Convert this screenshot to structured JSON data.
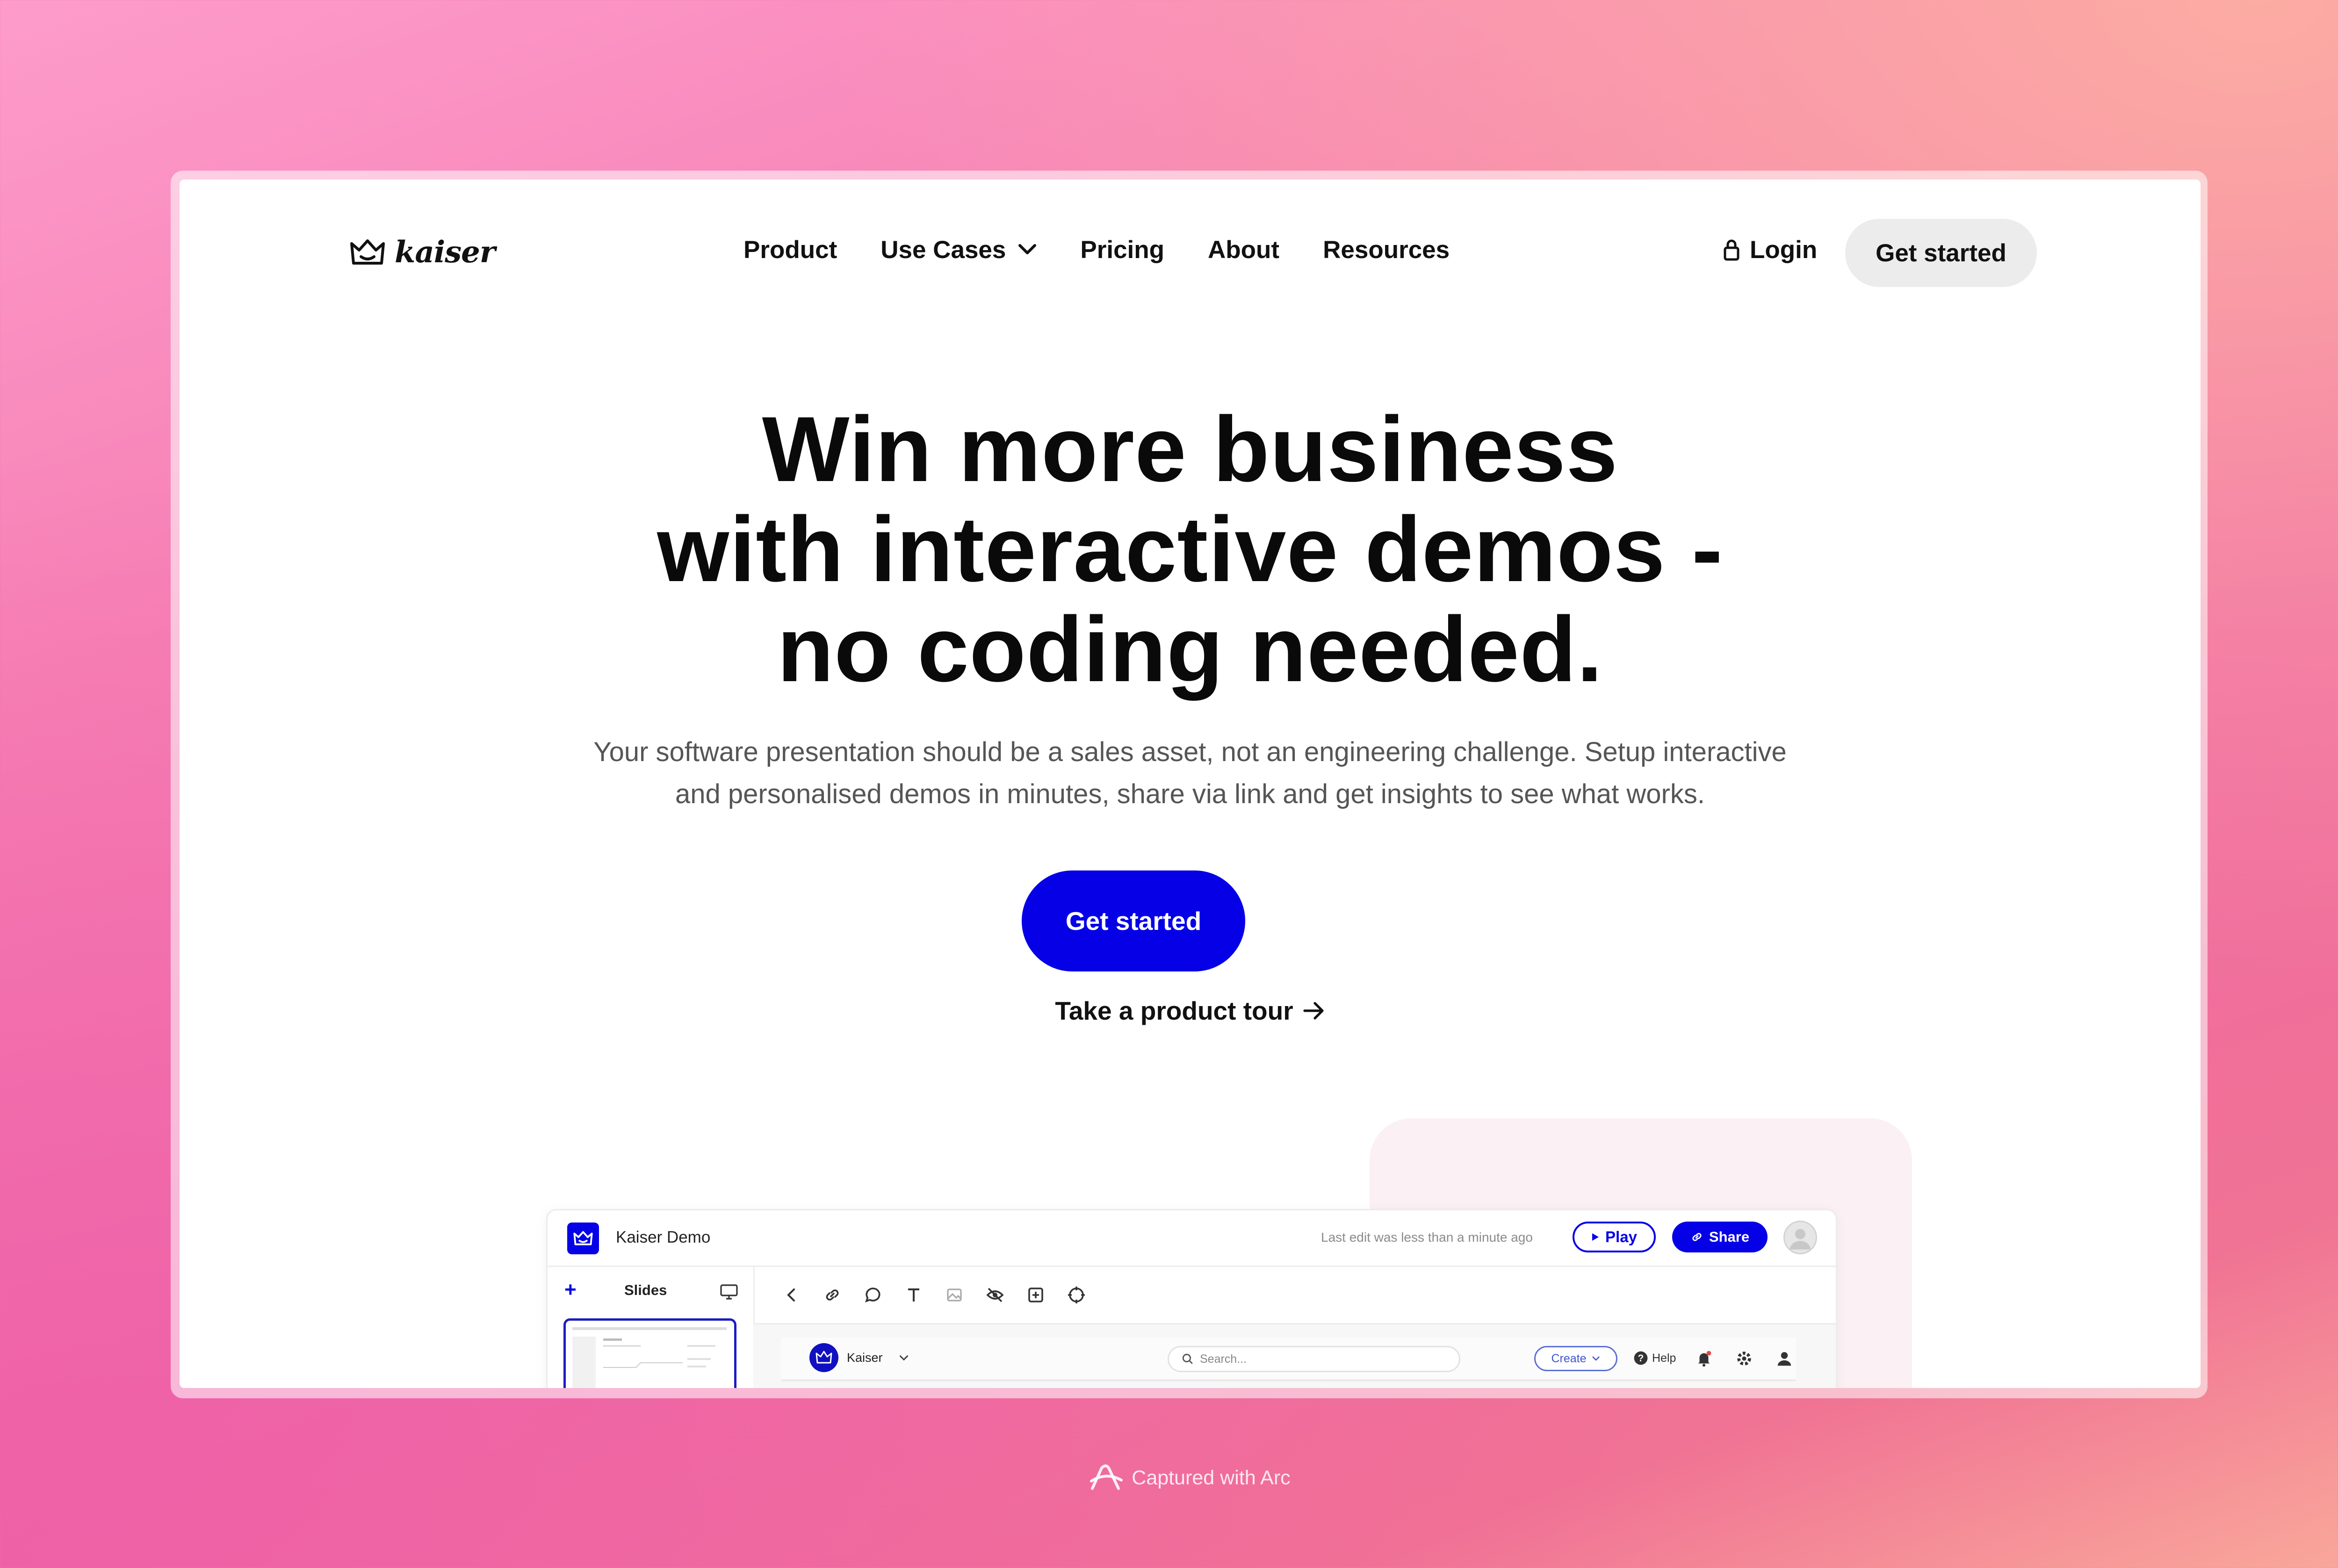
{
  "brand": {
    "name": "kaiser"
  },
  "nav": {
    "items": [
      {
        "label": "Product"
      },
      {
        "label": "Use Cases"
      },
      {
        "label": "Pricing"
      },
      {
        "label": "About"
      },
      {
        "label": "Resources"
      }
    ],
    "login_label": "Login",
    "cta_label": "Get started"
  },
  "hero": {
    "title_lines": [
      "Win more business",
      "with interactive demos -",
      "no coding needed."
    ],
    "subtitle_lines": [
      "Your software presentation should be a sales asset, not an engineering challenge. Setup interactive",
      "and personalised demos in minutes, share via link and get insights to see what works."
    ],
    "cta_label": "Get started",
    "tour_label": "Take a product tour"
  },
  "demo": {
    "title": "Kaiser Demo",
    "last_edit": "Last edit was less than a minute ago",
    "play_label": "Play",
    "share_label": "Share",
    "sidebar": {
      "add_symbol": "+",
      "slides_label": "Slides"
    },
    "toolbar_icons": [
      "chevron-left-icon",
      "link-icon",
      "comment-icon",
      "text-icon",
      "image-icon",
      "hide-icon",
      "add-box-icon",
      "target-icon"
    ],
    "inner": {
      "workspace_name": "Kaiser",
      "search_placeholder": "Search...",
      "create_label": "Create",
      "help_label": "Help"
    }
  },
  "footer": {
    "capture_text": "Captured with Arc"
  },
  "colors": {
    "accent": "#0500e6",
    "cta_secondary_bg": "#ececec",
    "text_dark": "#0a0a0a",
    "text_muted": "#555555"
  }
}
